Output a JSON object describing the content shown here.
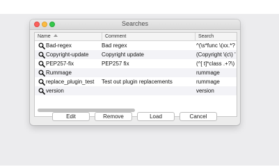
{
  "window": {
    "title": "Searches"
  },
  "table": {
    "columns": [
      "Name",
      "Comment",
      "Search"
    ],
    "sort_column": "Name",
    "sort_direction": "ascending",
    "rows": [
      {
        "icon": "magnifier-icon",
        "name": "Bad-regex",
        "comment": "Bad regex",
        "search": "^(\\s*func \\(xx.*?"
      },
      {
        "icon": "magnifier-icon",
        "name": "Copyright-update",
        "comment": "Copyright update",
        "search": "(Copyright \\(c\\) '"
      },
      {
        "icon": "magnifier-icon",
        "name": "PEP257-fix",
        "comment": "PEP257 fix",
        "search": "(^[ t]*class .+?\\)"
      },
      {
        "icon": "magnifier-icon",
        "name": "Rummage",
        "comment": "",
        "search": "rummage"
      },
      {
        "icon": "magnifier-icon",
        "name": "replace_plugin_test",
        "comment": "Test out plugin replacements",
        "search": "rummage"
      },
      {
        "icon": "magnifier-icon",
        "name": "version",
        "comment": "",
        "search": "version"
      }
    ]
  },
  "buttons": {
    "edit": "Edit",
    "remove": "Remove",
    "load": "Load",
    "cancel": "Cancel"
  }
}
